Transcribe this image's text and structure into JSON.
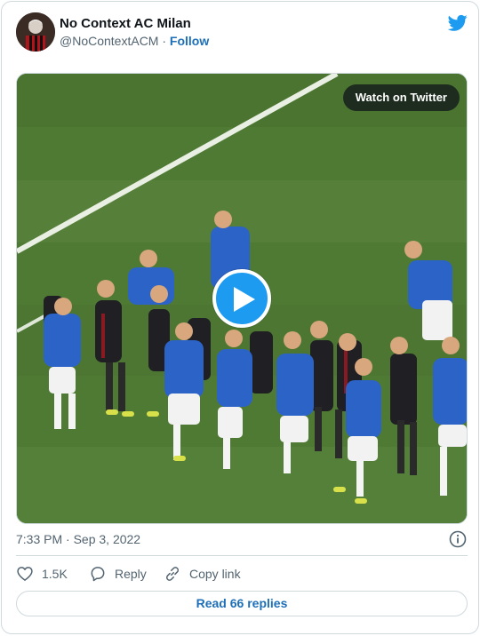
{
  "tweet": {
    "author_name": "No Context AC Milan",
    "author_handle": "@NoContextACM",
    "separator": "·",
    "follow_label": "Follow",
    "timestamp": "7:33 PM · Sep 3, 2022"
  },
  "media": {
    "watch_label": "Watch on Twitter",
    "play_icon": "play-icon"
  },
  "actions": {
    "like_count": "1.5K",
    "reply_label": "Reply",
    "copy_label": "Copy link"
  },
  "footer": {
    "read_replies_label": "Read 66 replies"
  },
  "colors": {
    "accent": "#1d9bf0",
    "link": "#1d6fb8",
    "muted": "#536471",
    "border": "#cfd9de",
    "pitch": "#4f7a34"
  },
  "icons": [
    "twitter-bird-icon",
    "play-icon",
    "info-icon",
    "heart-icon",
    "reply-icon",
    "link-icon"
  ]
}
